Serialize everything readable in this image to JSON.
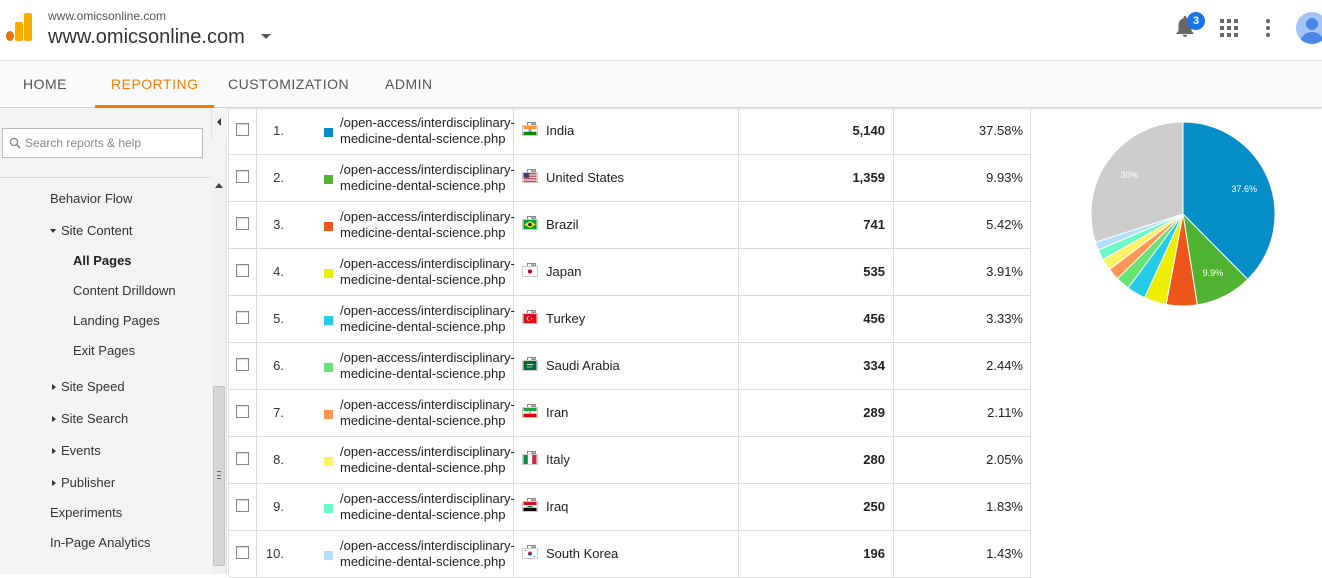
{
  "header": {
    "account_small": "www.omicsonline.com",
    "account_big": "www.omicsonline.com",
    "notification_count": "3"
  },
  "nav": {
    "tabs": [
      {
        "label": "HOME",
        "active": false
      },
      {
        "label": "REPORTING",
        "active": true
      },
      {
        "label": "CUSTOMIZATION",
        "active": false
      },
      {
        "label": "ADMIN",
        "active": false
      }
    ]
  },
  "sidebar": {
    "search_placeholder": "Search reports & help",
    "items": [
      {
        "label": "Behavior Flow",
        "level": 1,
        "expander": "none",
        "bold": false
      },
      {
        "label": "Site Content",
        "level": 1,
        "expander": "open",
        "bold": false
      },
      {
        "label": "All Pages",
        "level": 2,
        "expander": "none",
        "bold": true
      },
      {
        "label": "Content Drilldown",
        "level": 2,
        "expander": "none",
        "bold": false
      },
      {
        "label": "Landing Pages",
        "level": 2,
        "expander": "none",
        "bold": false
      },
      {
        "label": "Exit Pages",
        "level": 2,
        "expander": "none",
        "bold": false
      },
      {
        "label": "Site Speed",
        "level": 1,
        "expander": "closed",
        "bold": false
      },
      {
        "label": "Site Search",
        "level": 1,
        "expander": "closed",
        "bold": false
      },
      {
        "label": "Events",
        "level": 1,
        "expander": "closed",
        "bold": false
      },
      {
        "label": "Publisher",
        "level": 1,
        "expander": "closed",
        "bold": false
      },
      {
        "label": "Experiments",
        "level": 1,
        "expander": "none",
        "bold": false
      },
      {
        "label": "In-Page Analytics",
        "level": 1,
        "expander": "none",
        "bold": false
      }
    ]
  },
  "table": {
    "rows": [
      {
        "rank": "1.",
        "page": "/open-access/interdisciplinary-medicine-dental-science.php",
        "color": "#058dc7",
        "flag": "india",
        "country": "India",
        "sessions": "5,140",
        "pct": "37.58%"
      },
      {
        "rank": "2.",
        "page": "/open-access/interdisciplinary-medicine-dental-science.php",
        "color": "#50b432",
        "flag": "us",
        "country": "United States",
        "sessions": "1,359",
        "pct": "9.93%"
      },
      {
        "rank": "3.",
        "page": "/open-access/interdisciplinary-medicine-dental-science.php",
        "color": "#ed561b",
        "flag": "brazil",
        "country": "Brazil",
        "sessions": "741",
        "pct": "5.42%"
      },
      {
        "rank": "4.",
        "page": "/open-access/interdisciplinary-medicine-dental-science.php",
        "color": "#edef00",
        "flag": "japan",
        "country": "Japan",
        "sessions": "535",
        "pct": "3.91%"
      },
      {
        "rank": "5.",
        "page": "/open-access/interdisciplinary-medicine-dental-science.php",
        "color": "#24cbe5",
        "flag": "turkey",
        "country": "Turkey",
        "sessions": "456",
        "pct": "3.33%"
      },
      {
        "rank": "6.",
        "page": "/open-access/interdisciplinary-medicine-dental-science.php",
        "color": "#64e572",
        "flag": "saudi",
        "country": "Saudi Arabia",
        "sessions": "334",
        "pct": "2.44%"
      },
      {
        "rank": "7.",
        "page": "/open-access/interdisciplinary-medicine-dental-science.php",
        "color": "#ff9655",
        "flag": "iran",
        "country": "Iran",
        "sessions": "289",
        "pct": "2.11%"
      },
      {
        "rank": "8.",
        "page": "/open-access/interdisciplinary-medicine-dental-science.php",
        "color": "#fff263",
        "flag": "italy",
        "country": "Italy",
        "sessions": "280",
        "pct": "2.05%"
      },
      {
        "rank": "9.",
        "page": "/open-access/interdisciplinary-medicine-dental-science.php",
        "color": "#6af9c4",
        "flag": "iraq",
        "country": "Iraq",
        "sessions": "250",
        "pct": "1.83%"
      },
      {
        "rank": "10.",
        "page": "/open-access/interdisciplinary-medicine-dental-science.php",
        "color": "#b2deff",
        "flag": "korea",
        "country": "South Korea",
        "sessions": "196",
        "pct": "1.43%"
      }
    ]
  },
  "chart_data": {
    "type": "pie",
    "slices": [
      {
        "value": 37.58,
        "color": "#058dc7",
        "label": "37.6%"
      },
      {
        "value": 9.93,
        "color": "#50b432",
        "label": "9.9%"
      },
      {
        "value": 5.42,
        "color": "#ed561b",
        "label": ""
      },
      {
        "value": 3.91,
        "color": "#edef00",
        "label": ""
      },
      {
        "value": 3.33,
        "color": "#24cbe5",
        "label": ""
      },
      {
        "value": 2.44,
        "color": "#64e572",
        "label": ""
      },
      {
        "value": 2.11,
        "color": "#ff9655",
        "label": ""
      },
      {
        "value": 2.05,
        "color": "#fff263",
        "label": ""
      },
      {
        "value": 1.83,
        "color": "#6af9c4",
        "label": ""
      },
      {
        "value": 1.43,
        "color": "#b2deff",
        "label": ""
      },
      {
        "value": 29.97,
        "color": "#cccccc",
        "label": "30%"
      }
    ]
  }
}
